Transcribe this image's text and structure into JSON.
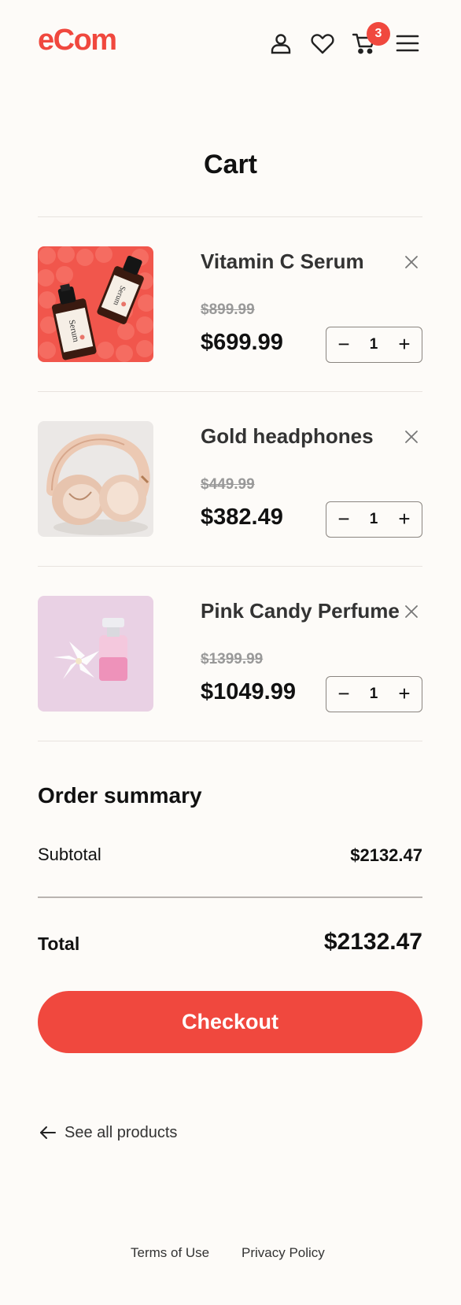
{
  "header": {
    "logo": "eCom",
    "icons": [
      "user-icon",
      "heart-icon",
      "cart-icon",
      "menu-icon"
    ],
    "cart_count": "3",
    "accent_color": "#f0483e"
  },
  "page": {
    "title": "Cart"
  },
  "cart": {
    "items": [
      {
        "name": "Vitamin C Serum",
        "old_price": "$899.99",
        "price": "$699.99",
        "quantity": "1",
        "minus": "−",
        "plus": "+"
      },
      {
        "name": "Gold headphones",
        "old_price": "$449.99",
        "price": "$382.49",
        "quantity": "1",
        "minus": "−",
        "plus": "+"
      },
      {
        "name": "Pink Candy Perfume",
        "old_price": "$1399.99",
        "price": "$1049.99",
        "quantity": "1",
        "minus": "−",
        "plus": "+"
      }
    ]
  },
  "summary": {
    "title": "Order summary",
    "subtotal_label": "Subtotal",
    "subtotal_value": "$2132.47",
    "total_label": "Total",
    "total_value": "$2132.47",
    "checkout_label": "Checkout"
  },
  "links": {
    "see_all": "See all products",
    "terms": "Terms of Use",
    "privacy": "Privacy Policy"
  }
}
